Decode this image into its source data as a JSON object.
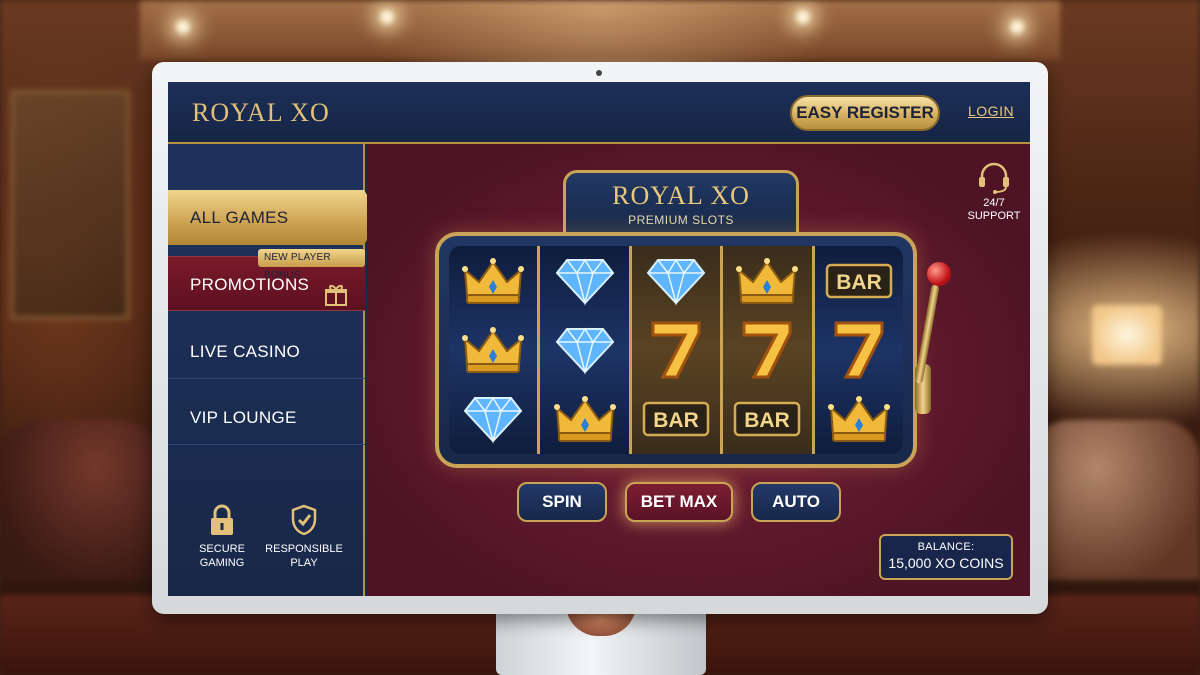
{
  "header": {
    "logo": "ROYAL XO",
    "register_label": "EASY REGISTER",
    "login_label": "LOGIN"
  },
  "sidebar": {
    "items": [
      {
        "label": "ALL GAMES",
        "active": true
      },
      {
        "label": "PROMOTIONS",
        "badge": "NEW PLAYER BONUS"
      },
      {
        "label": "LIVE CASINO"
      },
      {
        "label": "VIP LOUNGE"
      }
    ],
    "trust": [
      {
        "icon": "lock-icon",
        "label_1": "SECURE",
        "label_2": "GAMING"
      },
      {
        "icon": "shield-check-icon",
        "label_1": "RESPONSIBLE",
        "label_2": "PLAY"
      }
    ]
  },
  "support": {
    "icon": "headset-icon",
    "label_1": "24/7",
    "label_2": "SUPPORT"
  },
  "slot": {
    "title": "ROYAL XO",
    "subtitle": "PREMIUM SLOTS",
    "reels": [
      [
        "crown",
        "crown",
        "diamond"
      ],
      [
        "diamond",
        "diamond",
        "crown"
      ],
      [
        "diamond",
        "7",
        "BAR"
      ],
      [
        "crown",
        "7",
        "BAR"
      ],
      [
        "BAR",
        "7",
        "crown"
      ]
    ],
    "controls": {
      "spin": "SPIN",
      "bet_max": "BET MAX",
      "auto": "AUTO"
    }
  },
  "balance": {
    "label": "BALANCE:",
    "value": "15,000 XO COINS"
  },
  "colors": {
    "navy": "#1b2a4a",
    "gold": "#c9a455",
    "maroon": "#6e1a2e",
    "promo_red": "#7a1a2a"
  }
}
